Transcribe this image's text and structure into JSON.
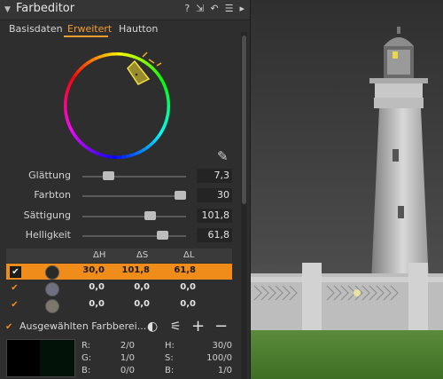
{
  "panel": {
    "title": "Farbeditor",
    "title_icons": [
      "?",
      "⇲",
      "↶",
      "☰",
      "▸"
    ],
    "tabs": [
      {
        "label": "Basisdaten",
        "active": false
      },
      {
        "label": "Erweitert",
        "active": true
      },
      {
        "label": "Hautton",
        "active": false
      }
    ]
  },
  "sliders": [
    {
      "label": "Glättung",
      "value": "7,3",
      "level": 0.25
    },
    {
      "label": "Farbton",
      "value": "30",
      "level": 0.94
    },
    {
      "label": "Sättigung",
      "value": "101,8",
      "level": 0.65
    },
    {
      "label": "Helligkeit",
      "value": "61,8",
      "level": 0.77
    }
  ],
  "table": {
    "headers": [
      "ΔH",
      "ΔS",
      "ΔL"
    ],
    "rows": [
      {
        "checked": true,
        "selected": true,
        "swatch": "#2b2a26",
        "dh": "30,0",
        "ds": "101,8",
        "dl": "61,8"
      },
      {
        "checked": true,
        "selected": false,
        "swatch": "#6e6f80",
        "dh": "0,0",
        "ds": "0,0",
        "dl": "0,0"
      },
      {
        "checked": true,
        "selected": false,
        "swatch": "#7d776b",
        "dh": "0,0",
        "ds": "0,0",
        "dl": "0,0"
      }
    ]
  },
  "selection": {
    "checked": true,
    "label": "Ausgewählten Farbberei...",
    "icons": [
      "color-range-icon",
      "wand-icon",
      "add-icon",
      "remove-icon"
    ]
  },
  "readout": {
    "R": "2/0",
    "G": "1/0",
    "B": "0/0",
    "H": "30/0",
    "S": "100/0",
    "Bv": "1/0",
    "labels": {
      "R": "R:",
      "G": "G:",
      "B": "B:",
      "H": "H:",
      "S": "S:",
      "Bv": "B:"
    }
  },
  "colors": {
    "accent": "#f08c1a",
    "panel": "#2e2e2e"
  }
}
